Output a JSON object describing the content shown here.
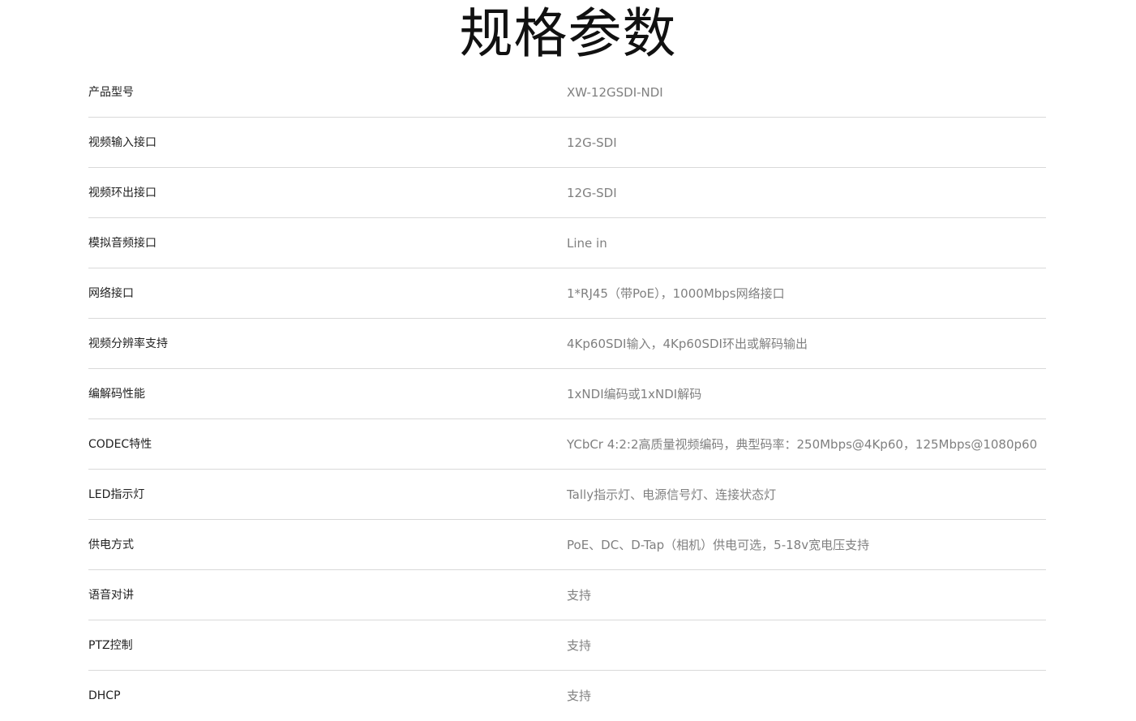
{
  "title": "规格参数",
  "rows": [
    {
      "label": "产品型号",
      "value": "XW-12GSDI-NDI"
    },
    {
      "label": "视频输入接口",
      "value": "12G-SDI"
    },
    {
      "label": "视频环出接口",
      "value": "12G-SDI"
    },
    {
      "label": "模拟音频接口",
      "value": "Line in"
    },
    {
      "label": "网络接口",
      "value": "1*RJ45（带PoE），1000Mbps网络接口"
    },
    {
      "label": "视频分辨率支持",
      "value": "4Kp60SDI输入，4Kp60SDI环出或解码输出"
    },
    {
      "label": "编解码性能",
      "value": "1xNDI编码或1xNDI解码"
    },
    {
      "label": "CODEC特性",
      "value": "YCbCr 4:2:2高质量视频编码，典型码率：250Mbps@4Kp60，125Mbps@1080p60"
    },
    {
      "label": "LED指示灯",
      "value": "Tally指示灯、电源信号灯、连接状态灯"
    },
    {
      "label": "供电方式",
      "value": "PoE、DC、D-Tap（相机）供电可选，5-18v宽电压支持"
    },
    {
      "label": "语音对讲",
      "value": "支持"
    },
    {
      "label": "PTZ控制",
      "value": "支持"
    },
    {
      "label": "DHCP",
      "value": "支持"
    }
  ]
}
